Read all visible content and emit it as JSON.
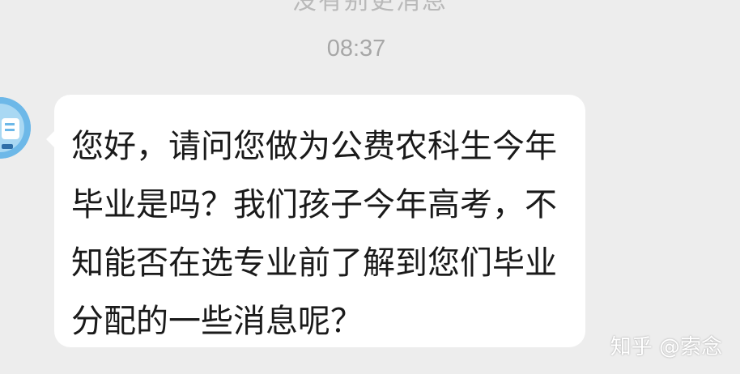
{
  "top_partial_text": "没有别更消息",
  "timestamp": "08:37",
  "message": {
    "sender": "other",
    "text": "您好，请问您做为公费农科生今年毕业是吗？我们孩子今年高考，不知能否在选专业前了解到您们毕业分配的一些消息呢？"
  },
  "avatar": {
    "icon": "avatar-icon",
    "color": "#6db8e8"
  },
  "watermark": "知乎 @索念",
  "colors": {
    "background": "#ededed",
    "bubble": "#ffffff",
    "timestamp": "#a7a7a7"
  }
}
